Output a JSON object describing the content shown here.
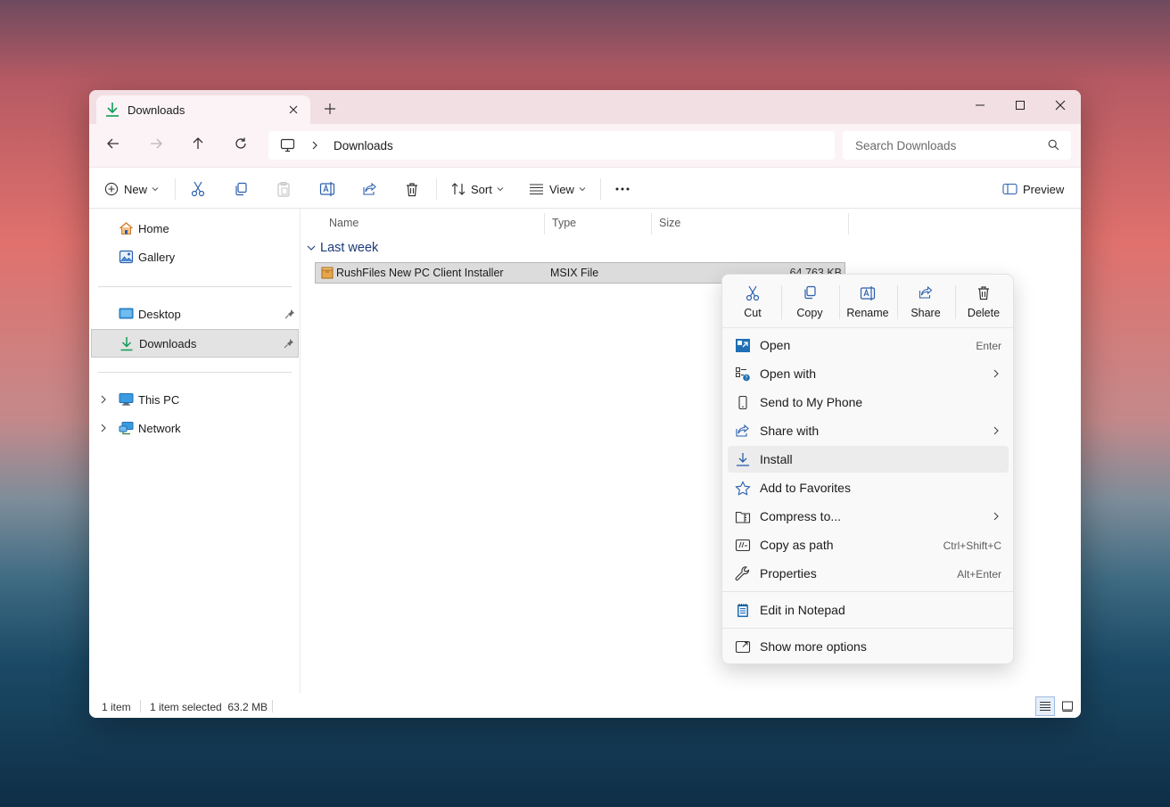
{
  "window": {
    "tab_title": "Downloads",
    "colors": {
      "titlebar": "#f2dfe3",
      "accent": "#0f6cbd",
      "selection": "#dcdcdc"
    }
  },
  "address": {
    "breadcrumb": "Downloads",
    "search_placeholder": "Search Downloads"
  },
  "toolbar": {
    "new_label": "New",
    "sort_label": "Sort",
    "view_label": "View",
    "preview_label": "Preview"
  },
  "sidebar": {
    "items": [
      {
        "label": "Home",
        "icon": "home-icon"
      },
      {
        "label": "Gallery",
        "icon": "gallery-icon"
      },
      {
        "label": "Desktop",
        "icon": "desktop-icon",
        "pinned": true
      },
      {
        "label": "Downloads",
        "icon": "downloads-icon",
        "pinned": true,
        "selected": true
      },
      {
        "label": "This PC",
        "icon": "this-pc-icon",
        "expandable": true
      },
      {
        "label": "Network",
        "icon": "network-icon",
        "expandable": true
      }
    ]
  },
  "columns": [
    "Name",
    "Type",
    "Size"
  ],
  "group": {
    "label": "Last week"
  },
  "files": [
    {
      "name": "RushFiles New PC Client Installer",
      "type": "MSIX File",
      "size": "64,763 KB",
      "icon": "msix-package-icon"
    }
  ],
  "status": {
    "count": "1 item",
    "selected": "1 item selected  63.2 MB"
  },
  "context_menu": {
    "quick_actions": [
      {
        "label": "Cut",
        "icon": "cut-icon"
      },
      {
        "label": "Copy",
        "icon": "copy-icon"
      },
      {
        "label": "Rename",
        "icon": "rename-icon"
      },
      {
        "label": "Share",
        "icon": "share-icon"
      },
      {
        "label": "Delete",
        "icon": "delete-icon"
      }
    ],
    "items": [
      {
        "label": "Open",
        "shortcut": "Enter",
        "icon": "open-icon"
      },
      {
        "label": "Open with",
        "submenu": true,
        "icon": "open-with-icon"
      },
      {
        "label": "Send to My Phone",
        "icon": "phone-icon"
      },
      {
        "label": "Share with",
        "submenu": true,
        "icon": "share-with-icon"
      },
      {
        "label": "Install",
        "icon": "install-icon",
        "highlighted": true
      },
      {
        "label": "Add to Favorites",
        "icon": "star-icon"
      },
      {
        "label": "Compress to...",
        "submenu": true,
        "icon": "compress-icon"
      },
      {
        "label": "Copy as path",
        "shortcut": "Ctrl+Shift+C",
        "icon": "copy-path-icon"
      },
      {
        "label": "Properties",
        "shortcut": "Alt+Enter",
        "icon": "wrench-icon"
      },
      {
        "label": "Edit in Notepad",
        "icon": "notepad-icon"
      },
      {
        "label": "Show more options",
        "icon": "more-options-icon"
      }
    ]
  }
}
